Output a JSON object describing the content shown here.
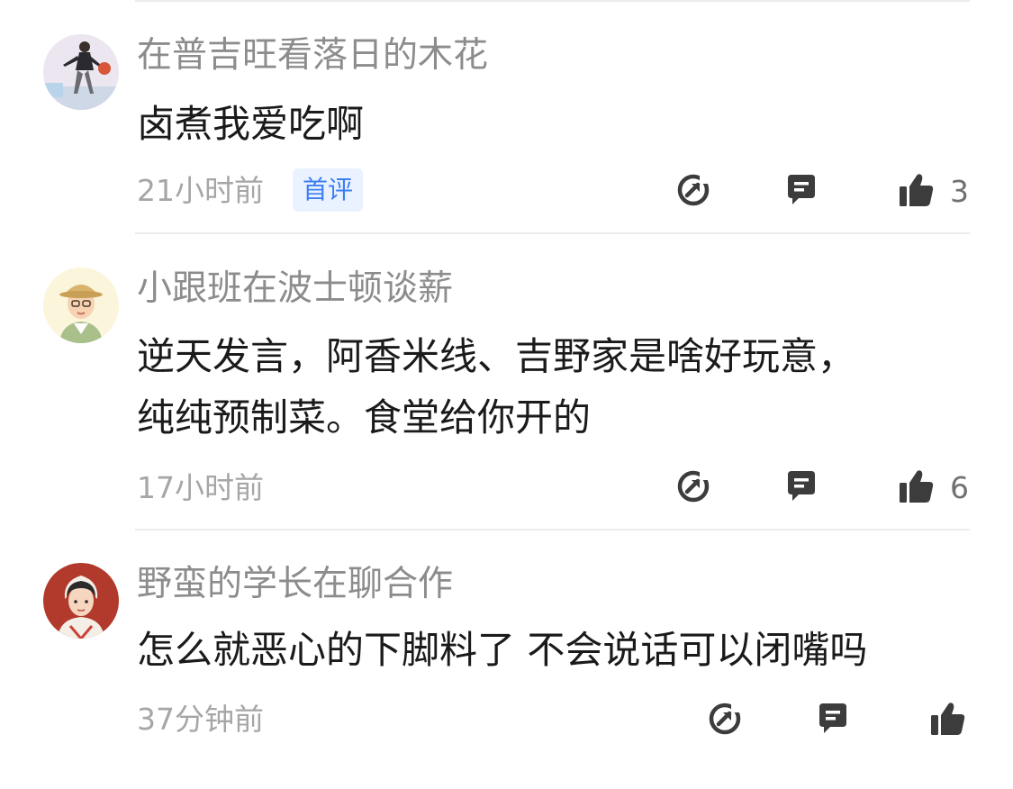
{
  "comments": [
    {
      "username": "在普吉旺看落日的木花",
      "content": [
        "卤煮我爱吃啊"
      ],
      "time": "21小时前",
      "badge": "首评",
      "likes": "3",
      "avatar": "avatar-basketball-player"
    },
    {
      "username": "小跟班在波士顿谈薪",
      "content": [
        "逆天发言，阿香米线、吉野家是啥好玩意，",
        "纯纯预制菜。食堂给你开的"
      ],
      "time": "17小时前",
      "likes": "6",
      "avatar": "avatar-hat-cartoon"
    },
    {
      "username": "野蛮的学长在聊合作",
      "content": [
        "怎么就恶心的下脚料了 不会说话可以闭嘴吗"
      ],
      "time": "37分钟前",
      "likes": "",
      "avatar": "avatar-cartoon-red-bg"
    }
  ],
  "icons": {
    "share": "share-icon",
    "reply": "reply-icon",
    "like": "thumbs-up-icon"
  },
  "colors": {
    "icon": "#3c3c3c",
    "badge_bg": "#eaf2ff",
    "badge_text": "#3d7ff2",
    "meta": "#a6a6a6"
  }
}
